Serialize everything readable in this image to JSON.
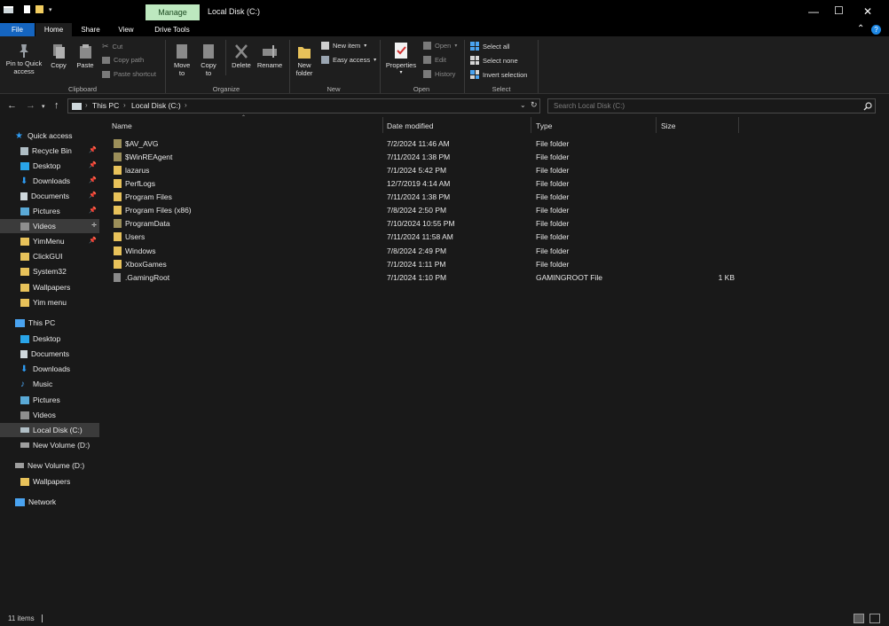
{
  "window": {
    "manage_tab": "Manage",
    "title": "Local Disk (C:)"
  },
  "ribbon_tabs": [
    "File",
    "Home",
    "Share",
    "View",
    "Drive Tools"
  ],
  "ribbon": {
    "pin_to_quick_access": "Pin to Quick access",
    "copy": "Copy",
    "paste": "Paste",
    "cut": "Cut",
    "copy_path": "Copy path",
    "paste_shortcut": "Paste shortcut",
    "move_to": "Move to",
    "copy_to": "Copy to",
    "delete": "Delete",
    "rename": "Rename",
    "new_folder": "New folder",
    "new_item": "New item",
    "easy_access": "Easy access",
    "properties": "Properties",
    "open": "Open",
    "edit": "Edit",
    "history": "History",
    "select_all": "Select all",
    "select_none": "Select none",
    "invert_selection": "Invert selection",
    "groups": {
      "clipboard": "Clipboard",
      "organize": "Organize",
      "new": "New",
      "open": "Open",
      "select": "Select"
    }
  },
  "address": {
    "crumbs": [
      "This PC",
      "Local Disk (C:)"
    ],
    "search_placeholder": "Search Local Disk (C:)"
  },
  "nav": {
    "quick_access": "Quick access",
    "quick_items": [
      "Recycle Bin",
      "Desktop",
      "Downloads",
      "Documents",
      "Pictures",
      "Videos",
      "YimMenu",
      "ClickGUI",
      "System32",
      "Wallpapers",
      "Yim menu"
    ],
    "this_pc": "This PC",
    "pc_items": [
      "Desktop",
      "Documents",
      "Downloads",
      "Music",
      "Pictures",
      "Videos",
      "Local Disk (C:)",
      "New Volume (D:)"
    ],
    "new_volume": "New Volume (D:)",
    "volume_items": [
      "Wallpapers"
    ],
    "network": "Network"
  },
  "columns": {
    "name": "Name",
    "date": "Date modified",
    "type": "Type",
    "size": "Size"
  },
  "files": [
    {
      "name": "$AV_AVG",
      "date": "7/2/2024 11:46 AM",
      "type": "File folder",
      "size": ""
    },
    {
      "name": "$WinREAgent",
      "date": "7/11/2024 1:38 PM",
      "type": "File folder",
      "size": ""
    },
    {
      "name": "lazarus",
      "date": "7/1/2024 5:42 PM",
      "type": "File folder",
      "size": ""
    },
    {
      "name": "PerfLogs",
      "date": "12/7/2019 4:14 AM",
      "type": "File folder",
      "size": ""
    },
    {
      "name": "Program Files",
      "date": "7/11/2024 1:38 PM",
      "type": "File folder",
      "size": ""
    },
    {
      "name": "Program Files (x86)",
      "date": "7/8/2024 2:50 PM",
      "type": "File folder",
      "size": ""
    },
    {
      "name": "ProgramData",
      "date": "7/10/2024 10:55 PM",
      "type": "File folder",
      "size": ""
    },
    {
      "name": "Users",
      "date": "7/11/2024 11:58 AM",
      "type": "File folder",
      "size": ""
    },
    {
      "name": "Windows",
      "date": "7/8/2024 2:49 PM",
      "type": "File folder",
      "size": ""
    },
    {
      "name": "XboxGames",
      "date": "7/1/2024 1:11 PM",
      "type": "File folder",
      "size": ""
    },
    {
      "name": ".GamingRoot",
      "date": "7/1/2024 1:10 PM",
      "type": "GAMINGROOT File",
      "size": "1 KB"
    }
  ],
  "status": {
    "item_count": "11 items"
  },
  "colors": {
    "accent": "#1565c0",
    "manage_tab": "#bde8bf",
    "folder": "#e8c25a",
    "background": "#191919"
  }
}
